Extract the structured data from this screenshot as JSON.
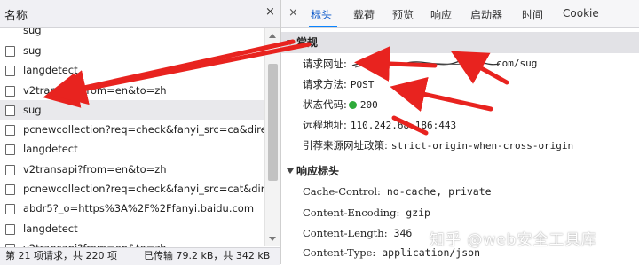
{
  "left_panel": {
    "column_header": "名称",
    "close_glyph": "×",
    "rows": [
      {
        "name": "sug"
      },
      {
        "name": "langdetect"
      },
      {
        "name": "v2transapi?from=en&to=zh"
      },
      {
        "name": "sug",
        "selected": true
      },
      {
        "name": "pcnewcollection?req=check&fanyi_src=ca&directi"
      },
      {
        "name": "langdetect"
      },
      {
        "name": "v2transapi?from=en&to=zh"
      },
      {
        "name": "pcnewcollection?req=check&fanyi_src=cat&direct"
      },
      {
        "name": "abdr5?_o=https%3A%2F%2Ffanyi.baidu.com"
      },
      {
        "name": "langdetect"
      },
      {
        "name": "v2transapi?from=en&to=zh"
      }
    ],
    "status_left": "第 21 项请求，共 220 项",
    "status_right": "已传输 79.2 kB，共 342 kB"
  },
  "right_panel": {
    "close_glyph": "×",
    "tabs": [
      {
        "label": "标头",
        "active": true
      },
      {
        "label": "载荷"
      },
      {
        "label": "预览"
      },
      {
        "label": "响应"
      },
      {
        "label": "启动器"
      },
      {
        "label": "时间"
      },
      {
        "label": "Cookie"
      }
    ],
    "general": {
      "title": "常规",
      "request_url_label": "请求网址:",
      "request_url_value": "com/sug",
      "method_label": "请求方法:",
      "method_value": "POST",
      "status_label": "状态代码:",
      "status_value": "200",
      "remote_label": "远程地址:",
      "remote_value": "110.242.68.186:443",
      "referrer_label": "引荐来源网址政策:",
      "referrer_value": "strict-origin-when-cross-origin"
    },
    "response_headers": {
      "title": "响应标头",
      "items": [
        {
          "key": "Cache-Control:",
          "value": "no-cache, private"
        },
        {
          "key": "Content-Encoding:",
          "value": "gzip"
        },
        {
          "key": "Content-Length:",
          "value": "346"
        },
        {
          "key": "Content-Type:",
          "value": "application/json"
        }
      ]
    }
  },
  "watermark": "知乎 @web安全工具库",
  "colors": {
    "annotation_arrow": "#e8231f",
    "status_dot": "#2eaa3a",
    "active_tab": "#0a84ff"
  }
}
